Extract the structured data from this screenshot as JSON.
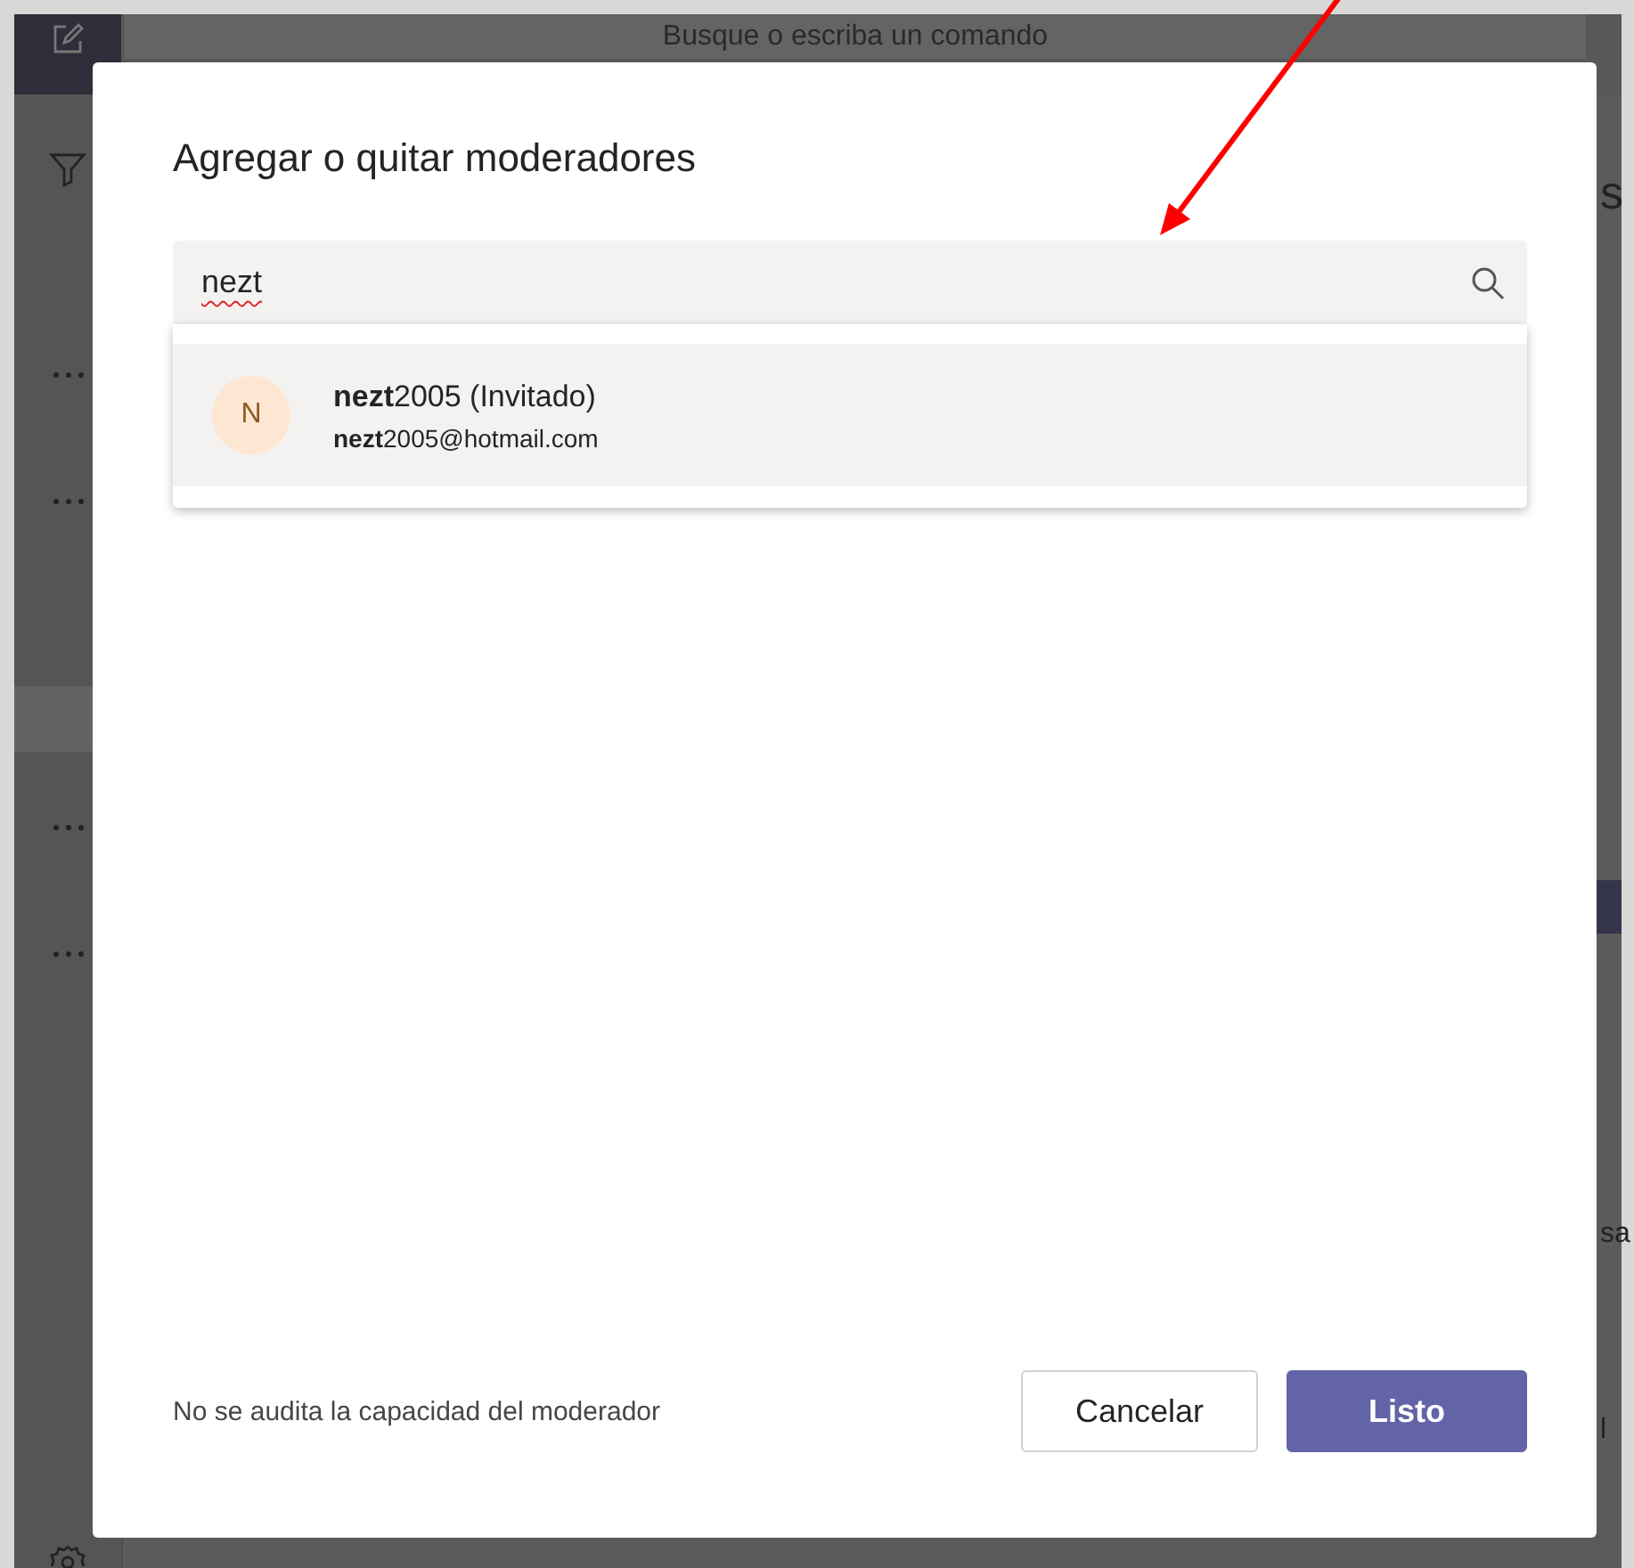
{
  "app": {
    "search": {
      "placeholder": "Busque o escriba un comando"
    },
    "background_texts": [
      "s",
      "sa",
      "l"
    ]
  },
  "dialog": {
    "title": "Agregar o quitar moderadores",
    "search": {
      "value": "nezt"
    },
    "results": [
      {
        "initial": "N",
        "name": "**nezt**2005 (Invitado)",
        "email": "**nezt**2005@hotmail.com",
        "selected": true
      }
    ],
    "note": "No se audita la capacidad del moderador",
    "buttons": [
      {
        "label": "Cancelar",
        "kind": "secondary"
      },
      {
        "label": "Listo",
        "kind": "primary"
      }
    ]
  }
}
